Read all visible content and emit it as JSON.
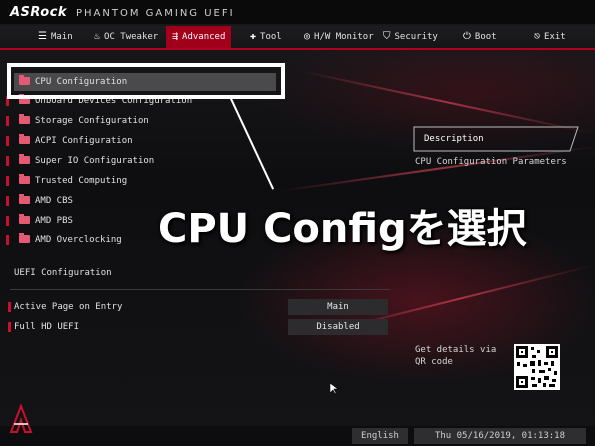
{
  "brand": {
    "logo": "ASRock",
    "subtitle": "PHANTOM GAMING UEFI"
  },
  "nav": [
    {
      "label": "Main",
      "icon": "list-icon",
      "active": false
    },
    {
      "label": "OC Tweaker",
      "icon": "flame-icon",
      "active": false
    },
    {
      "label": "Advanced",
      "icon": "advanced-icon",
      "active": true
    },
    {
      "label": "Tool",
      "icon": "tool-icon",
      "active": false
    },
    {
      "label": "H/W Monitor",
      "icon": "monitor-icon",
      "active": false
    },
    {
      "label": "Security",
      "icon": "shield-icon",
      "active": false
    },
    {
      "label": "Boot",
      "icon": "power-icon",
      "active": false
    },
    {
      "label": "Exit",
      "icon": "exit-icon",
      "active": false
    }
  ],
  "menu": [
    {
      "label": "CPU Configuration",
      "selected": true
    },
    {
      "label": "Onboard Devices Configuration",
      "selected": false
    },
    {
      "label": "Storage Configuration",
      "selected": false
    },
    {
      "label": "ACPI Configuration",
      "selected": false
    },
    {
      "label": "Super IO Configuration",
      "selected": false
    },
    {
      "label": "Trusted Computing",
      "selected": false
    },
    {
      "label": "AMD CBS",
      "selected": false
    },
    {
      "label": "AMD PBS",
      "selected": false
    },
    {
      "label": "AMD Overclocking",
      "selected": false
    }
  ],
  "uefi_section": {
    "title": "UEFI Configuration",
    "settings": [
      {
        "label": "Active Page on Entry",
        "value": "Main"
      },
      {
        "label": "Full HD UEFI",
        "value": "Disabled"
      }
    ]
  },
  "description": {
    "title": "Description",
    "text": "CPU Configuration Parameters"
  },
  "qr": {
    "text": "Get details via QR code"
  },
  "annotation": {
    "text": "CPU Configを選択"
  },
  "footer": {
    "language": "English",
    "datetime": "Thu 05/16/2019, 01:13:18"
  },
  "colors": {
    "accent": "#b3001e",
    "folder": "#e35a72",
    "background": "#0d0d0f"
  }
}
